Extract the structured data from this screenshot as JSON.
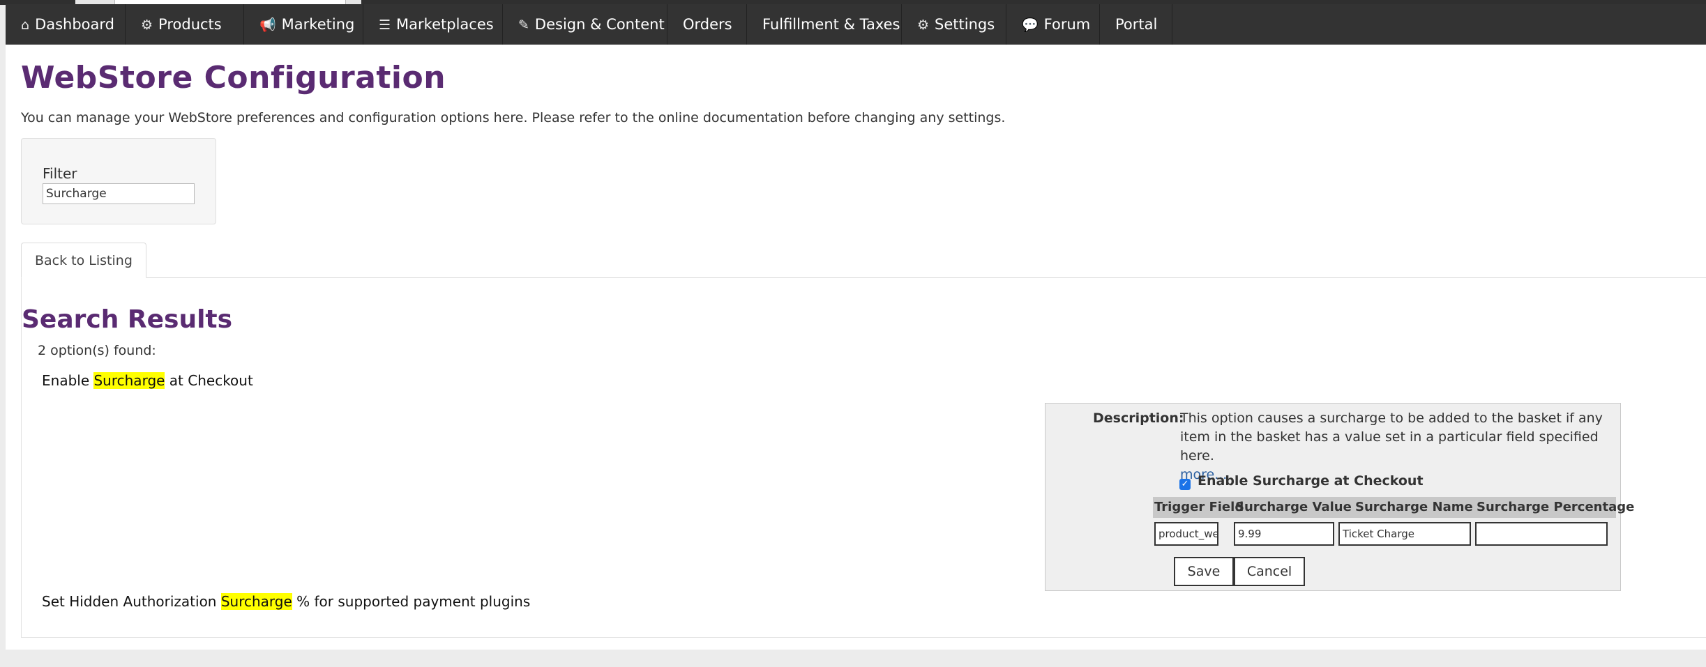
{
  "nav": {
    "items": [
      {
        "label": "Dashboard",
        "icon": "home-icon",
        "glyph": "⌂"
      },
      {
        "label": "Products",
        "icon": "cubes-icon",
        "glyph": "⚙"
      },
      {
        "label": "Marketing",
        "icon": "bullhorn-icon",
        "glyph": "📢"
      },
      {
        "label": "Marketplaces",
        "icon": "list-icon",
        "glyph": "☰"
      },
      {
        "label": "Design & Content",
        "icon": "brush-icon",
        "glyph": "✎"
      },
      {
        "label": "Orders",
        "icon": "",
        "glyph": ""
      },
      {
        "label": "Fulfillment & Taxes",
        "icon": "",
        "glyph": ""
      },
      {
        "label": "Settings",
        "icon": "gear-icon",
        "glyph": "⚙"
      },
      {
        "label": "Forum",
        "icon": "comment-icon",
        "glyph": "💬"
      },
      {
        "label": "Portal",
        "icon": "",
        "glyph": ""
      }
    ]
  },
  "page": {
    "title": "WebStore Configuration",
    "intro": "You can manage your WebStore preferences and configuration options here. Please refer to the online documentation before changing any settings."
  },
  "filter": {
    "label": "Filter",
    "value": "Surcharge"
  },
  "tabs": {
    "back": "Back to Listing"
  },
  "results": {
    "title": "Search Results",
    "count": "2 option(s) found:",
    "options": [
      {
        "before": "Enable ",
        "highlight": "Surcharge",
        "after": " at Checkout"
      },
      {
        "before": "Set Hidden Authorization ",
        "highlight": "Surcharge",
        "after": " % for supported payment plugins"
      }
    ]
  },
  "editor": {
    "description_label": "Description:",
    "description_text": "This option causes a surcharge to be added to the basket if any item in the basket has a value set in a particular field specified here.",
    "more_link": "more...",
    "checkbox_label": "Enable Surcharge at Checkout",
    "checkbox_checked": true,
    "columns": [
      "Trigger Field",
      "Surcharge Value",
      "Surcharge Name",
      "Surcharge Percentage"
    ],
    "values": [
      "product_wei",
      "9.99",
      "Ticket Charge",
      ""
    ],
    "save": "Save",
    "cancel": "Cancel"
  },
  "colors": {
    "navbar": "#333333",
    "title_purple": "#5a2b72",
    "highlight": "#ffff00",
    "link": "#2a5fa0",
    "checkbox": "#1a73e8"
  }
}
